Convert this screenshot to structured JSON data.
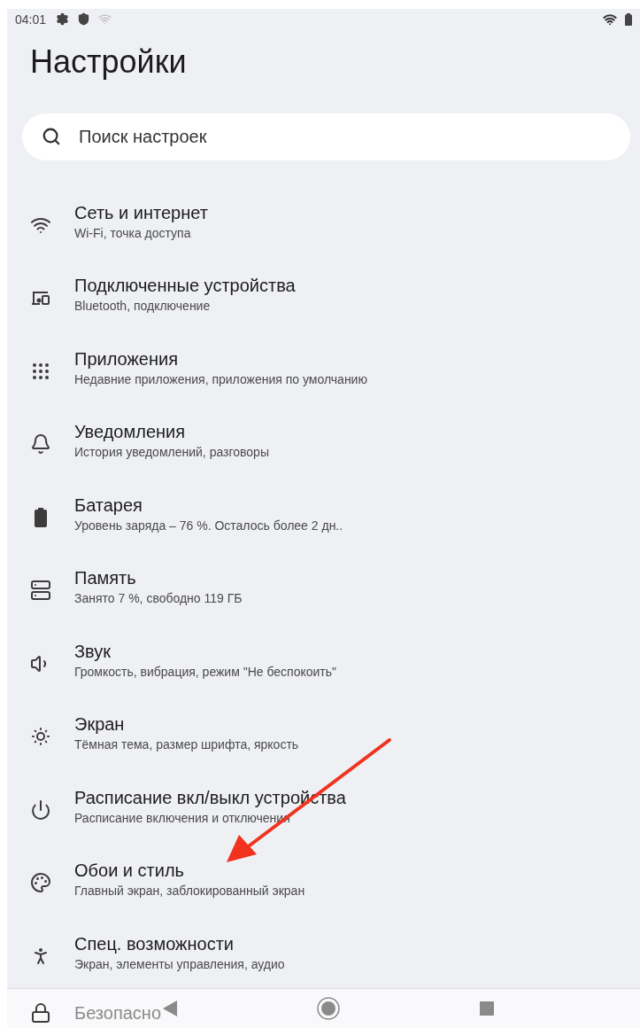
{
  "status_bar": {
    "time": "04:01"
  },
  "title": "Настройки",
  "search": {
    "placeholder": "Поиск настроек"
  },
  "items": [
    {
      "title": "Сеть и интернет",
      "subtitle": "Wi-Fi, точка доступа"
    },
    {
      "title": "Подключенные устройства",
      "subtitle": "Bluetooth, подключение"
    },
    {
      "title": "Приложения",
      "subtitle": "Недавние приложения, приложения по умолчанию"
    },
    {
      "title": "Уведомления",
      "subtitle": "История уведомлений, разговоры"
    },
    {
      "title": "Батарея",
      "subtitle": "Уровень заряда – 76 %. Осталось более 2 дн.."
    },
    {
      "title": "Память",
      "subtitle": "Занято 7 %, свободно 119 ГБ"
    },
    {
      "title": "Звук",
      "subtitle": "Громкость, вибрация, режим \"Не беспокоить\""
    },
    {
      "title": "Экран",
      "subtitle": "Тёмная тема, размер шрифта, яркость"
    },
    {
      "title": "Расписание вкл/выкл устройства",
      "subtitle": "Расписание включения и отключения"
    },
    {
      "title": "Обои и стиль",
      "subtitle": "Главный экран, заблокированный экран"
    },
    {
      "title": "Спец. возможности",
      "subtitle": "Экран, элементы управления, аудио"
    },
    {
      "title": "Безопасно"
    }
  ]
}
